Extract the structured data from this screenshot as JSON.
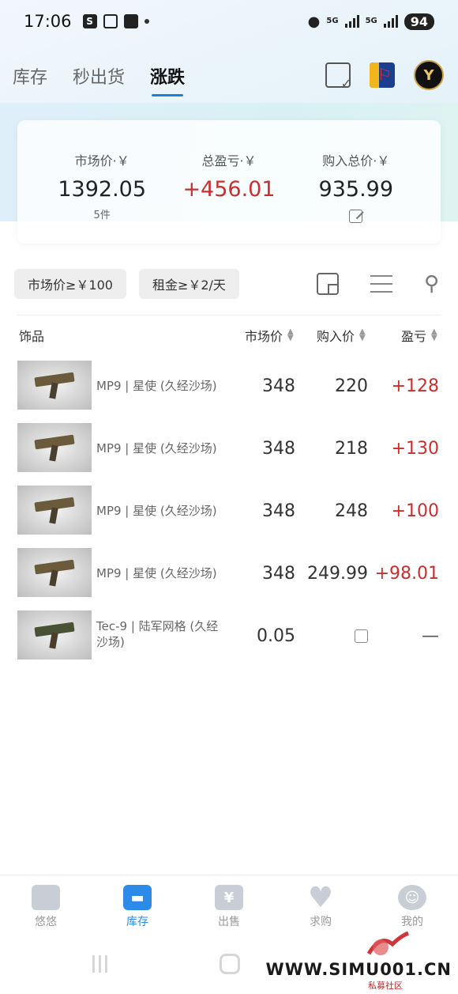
{
  "status_bar": {
    "time": "17:06",
    "net1": "5G",
    "net2": "5G",
    "battery": "94"
  },
  "tabs": [
    {
      "label": "库存",
      "active": false
    },
    {
      "label": "秒出货",
      "active": false
    },
    {
      "label": "涨跌",
      "active": true
    }
  ],
  "header_actions": {
    "avatar_text": "Y"
  },
  "summary": {
    "market_label": "市场价·￥",
    "market_value": "1392.05",
    "market_count": "5件",
    "profit_label": "总盈亏·￥",
    "profit_value": "+456.01",
    "cost_label": "购入总价·￥",
    "cost_value": "935.99"
  },
  "filters": {
    "chip1": "市场价≥￥100",
    "chip2": "租金≥￥2/天"
  },
  "table": {
    "headers": {
      "item": "饰品",
      "market": "市场价",
      "cost": "购入价",
      "profit": "盈亏"
    },
    "rows": [
      {
        "name": "MP9 | 星使 (久经沙场)",
        "market": "348",
        "cost": "220",
        "profit": "+128"
      },
      {
        "name": "MP9 | 星使 (久经沙场)",
        "market": "348",
        "cost": "218",
        "profit": "+130"
      },
      {
        "name": "MP9 | 星使 (久经沙场)",
        "market": "348",
        "cost": "248",
        "profit": "+100"
      },
      {
        "name": "MP9 | 星使 (久经沙场)",
        "market": "348",
        "cost": "249.99",
        "profit": "+98.01"
      },
      {
        "name": "Tec-9 | 陆军网格 (久经沙场)",
        "market": "0.05",
        "cost": "",
        "profit": "—"
      }
    ]
  },
  "bottom_nav": [
    {
      "label": "悠悠",
      "active": false
    },
    {
      "label": "库存",
      "active": true
    },
    {
      "label": "出售",
      "active": false,
      "glyph": "¥"
    },
    {
      "label": "求购",
      "active": false
    },
    {
      "label": "我的",
      "active": false
    }
  ],
  "watermark": {
    "text": "WWW.SIMU001.CN",
    "sub": "私募社区"
  },
  "colors": {
    "accent": "#2c8be8",
    "profit_red": "#c7302e",
    "tab_underline": "#1e7fd8"
  }
}
